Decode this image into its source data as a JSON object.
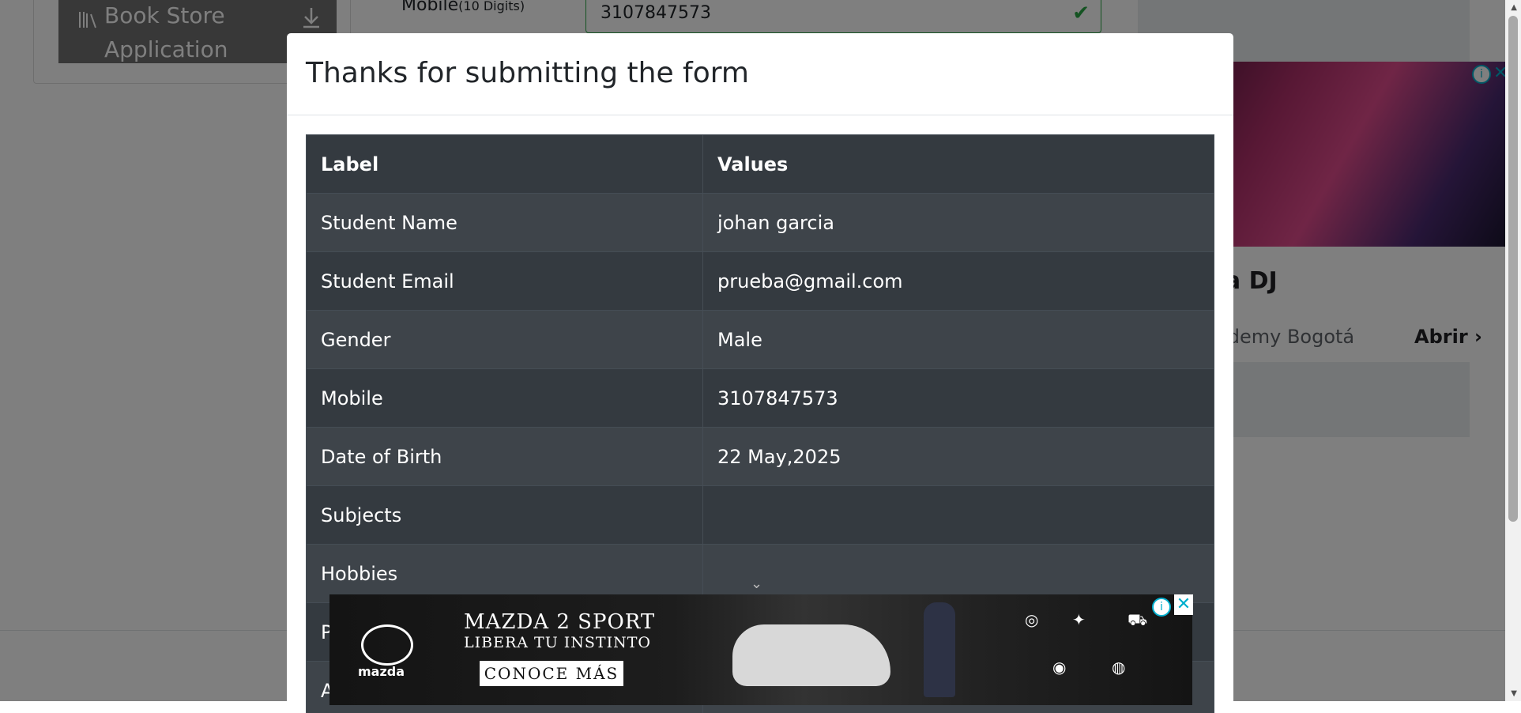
{
  "background": {
    "sidebar_item": {
      "line1": "Book Store",
      "line2": "Application"
    },
    "form": {
      "mobile_label": "Mobile",
      "mobile_hint": "(10 Digits)",
      "mobile_value": "3107847573"
    },
    "side_ad": {
      "title": "emia DJ",
      "subtitle": "y Academy Bogotá",
      "cta": "Abrir"
    }
  },
  "modal": {
    "title": "Thanks for submitting the form",
    "table": {
      "headers": [
        "Label",
        "Values"
      ],
      "rows": [
        {
          "label": "Student Name",
          "value": "johan garcia"
        },
        {
          "label": "Student Email",
          "value": "prueba@gmail.com"
        },
        {
          "label": "Gender",
          "value": "Male"
        },
        {
          "label": "Mobile",
          "value": "3107847573"
        },
        {
          "label": "Date of Birth",
          "value": "22 May,2025"
        },
        {
          "label": "Subjects",
          "value": ""
        },
        {
          "label": "Hobbies",
          "value": ""
        },
        {
          "label": "P",
          "value": ""
        },
        {
          "label": "A",
          "value": ""
        }
      ]
    }
  },
  "bottom_ad": {
    "brand": "mazda",
    "headline": "MAZDA 2 SPORT",
    "tagline": "LIBERA TU INSTINTO",
    "cta": "CONOCE MÁS"
  },
  "colors": {
    "table_header_bg": "#343a40",
    "table_alt_bg": "#3e444a",
    "success": "#28a745",
    "ad_accent": "#00aecd"
  }
}
